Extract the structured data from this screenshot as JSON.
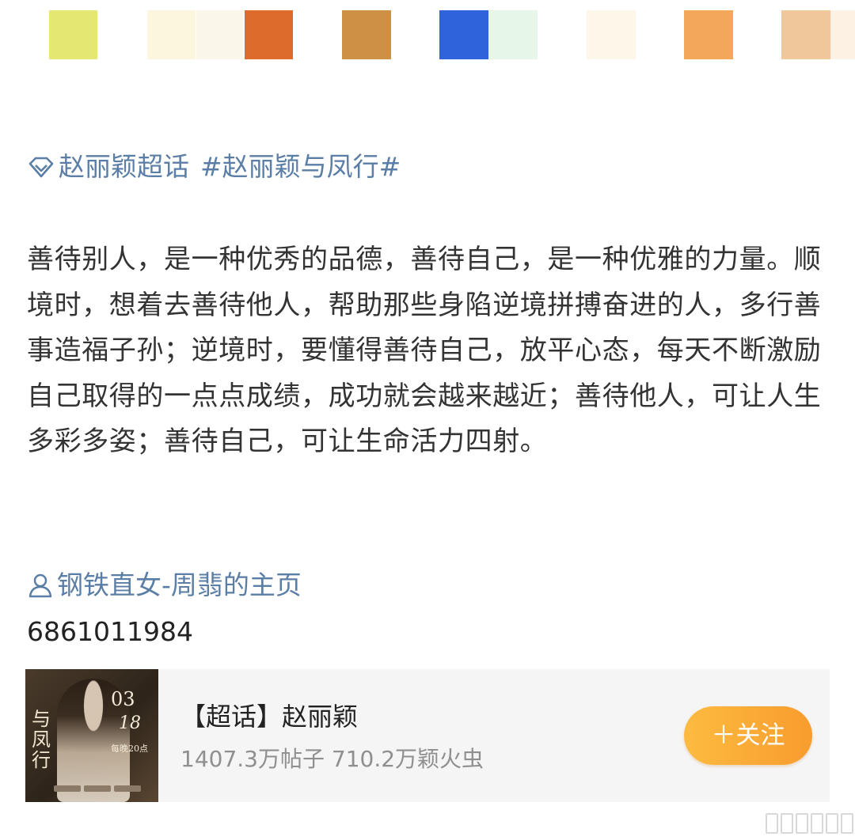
{
  "swatches": [
    {
      "color": "#e4e872"
    },
    {
      "color": "#fdf6df"
    },
    {
      "color": "#fbf6ea"
    },
    {
      "color": "#dd6c2c"
    },
    {
      "color": "#cd9044"
    },
    {
      "color": "#2f63db"
    },
    {
      "color": "#e6f7ea"
    },
    {
      "color": "#fdf7ea"
    },
    {
      "color": "#f3a75a"
    },
    {
      "color": "#f0c79b"
    },
    {
      "color": "#fcf1e2"
    }
  ],
  "topic": {
    "icon": "diamond-icon",
    "supertopic": "赵丽颖超话",
    "hashtag": "#赵丽颖与凤行#"
  },
  "post": {
    "text": "善待别人，是一种优秀的品德，善待自己，是一种优雅的力量。顺境时，想着去善待他人，帮助那些身陷逆境拼搏奋进的人，多行善事造福子孙；逆境时，要懂得善待自己，放平心态，每天不断激励自己取得的一点点成绩，成功就会越来越近；善待他人，可让人生多彩多姿；善待自己，可让生命活力四射。"
  },
  "user": {
    "icon": "user-icon",
    "link_label": "钢铁直女-周翡的主页",
    "id": "6861011984"
  },
  "card": {
    "cover": {
      "title": "与凤行",
      "date_month": "03",
      "date_day": "18",
      "schedule": "每晚20点"
    },
    "title": "【超话】赵丽颖",
    "stats": "1407.3万帖子 710.2万颖火虫",
    "follow_label": "＋关注",
    "accent": "#f89c2e"
  }
}
